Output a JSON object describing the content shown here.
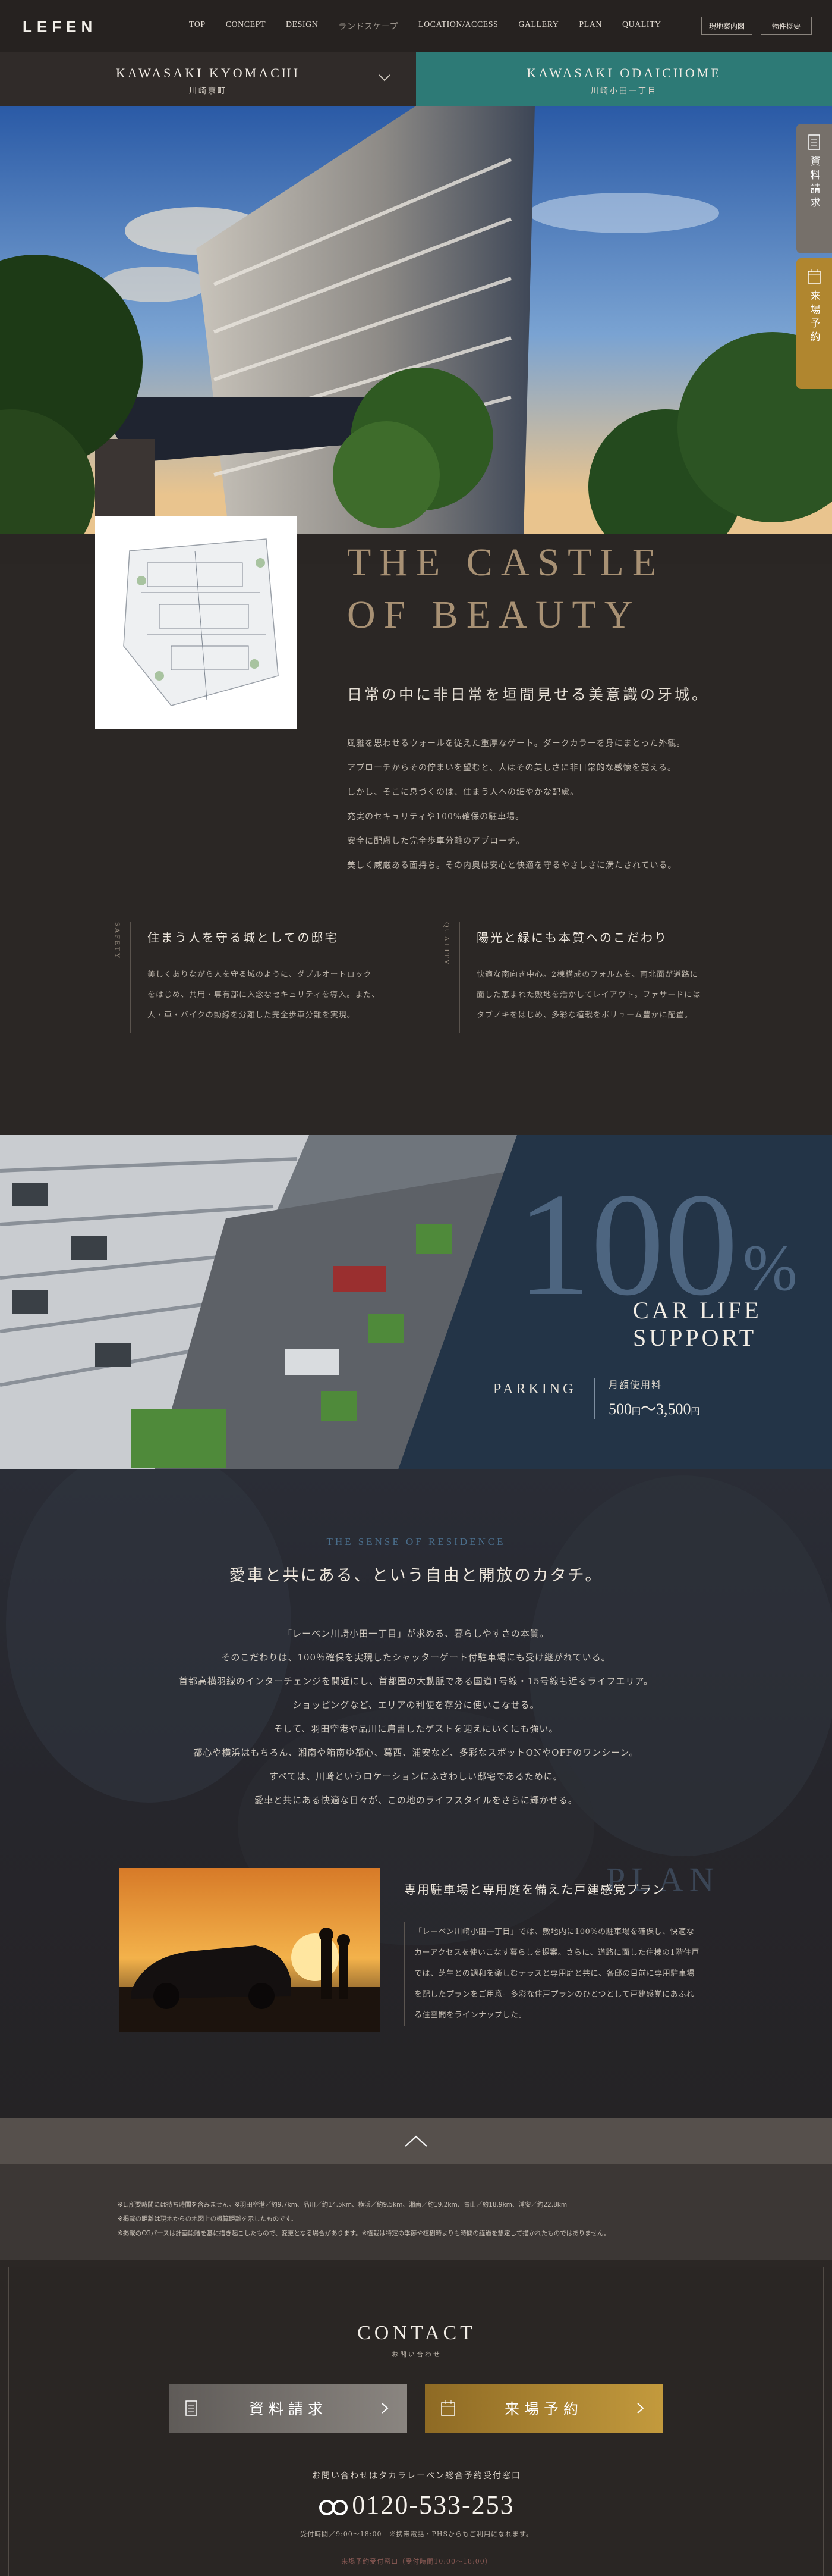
{
  "header": {
    "logo": "LEFEN",
    "nav": [
      "TOP",
      "CONCEPT",
      "DESIGN",
      "ランドスケープ",
      "LOCATION/ACCESS",
      "GALLERY",
      "PLAN",
      "QUALITY"
    ],
    "btn_map": "現地案内図",
    "btn_outline": "物件概要"
  },
  "tabs": [
    {
      "title": "KAWASAKI KYOMACHI",
      "sub": "川崎京町"
    },
    {
      "title": "KAWASAKI ODAICHOME",
      "sub": "川崎小田一丁目"
    }
  ],
  "side": {
    "request": "資料請求",
    "visit": "来場予約"
  },
  "intro": {
    "castle_line1": "THE CASTLE",
    "castle_line2": "OF BEAUTY",
    "lead": "日常の中に非日常を垣間見せる美意識の牙城。",
    "body": [
      "風雅を思わせるウォールを従えた重厚なゲート。ダークカラーを身にまとった外観。",
      "アプローチからその佇まいを望むと、人はその美しさに非日常的な感懐を覚える。",
      "しかし、そこに息づくのは、住まう人への細やかな配慮。",
      "充実のセキュリティや100%確保の駐車場。",
      "安全に配慮した完全歩車分離のアプローチ。",
      "美しく威厳ある面持ち。その内奥は安心と快適を守るやさしさに満たされている。"
    ]
  },
  "features": [
    {
      "tag": "SAFETY",
      "title": "住まう人を守る城としての邸宅",
      "text": [
        "美しくありながら人を守る城のように、ダブルオートロック",
        "をはじめ、共用・専有部に入念なセキュリティを導入。また、",
        "人・車・バイクの動線を分離した完全歩車分離を実現。"
      ]
    },
    {
      "tag": "QUALITY",
      "title": "陽光と緑にも本質へのこだわり",
      "text": [
        "快適な南向き中心。2棟構成のフォルムを、南北面が道路に",
        "面した恵まれた敷地を活かしてレイアウト。ファサードには",
        "タブノキをはじめ、多彩な植栽をボリューム豊かに配置。"
      ]
    }
  ],
  "parking": {
    "big": "100",
    "pct": "%",
    "line1": "CAR LIFE",
    "line2": "SUPPORT",
    "label": "PARKING",
    "fee_label": "月額使用料",
    "fee_from": "500",
    "fee_unit1": "円",
    "fee_sep": "〜",
    "fee_to": "3,500",
    "fee_unit2": "円"
  },
  "sense": {
    "sub": "THE SENSE OF RESIDENCE",
    "head": "愛車と共にある、という自由と開放のカタチ。",
    "body": [
      "「レーベン川崎小田一丁目」が求める、暮らしやすさの本質。",
      "そのこだわりは、100％確保を実現したシャッターゲート付駐車場にも受け継がれている。",
      "首都高横羽線のインターチェンジを間近にし、首都圏の大動脈である国道1号線・15号線も近るライフエリア。",
      "ショッピングなど、エリアの利便を存分に使いこなせる。",
      "そして、羽田空港や品川に肩書したゲストを迎えにいくにも強い。",
      "都心や横浜はもちろん、湘南や箱南ゆ都心、葛西、浦安など、多彩なスポットONやOFFのワンシーン。",
      "すべては、川崎というロケーションにふさわしい邸宅であるために。",
      "愛車と共にある快適な日々が、この地のライフスタイルをさらに輝かせる。"
    ],
    "plan_word": "PLAN",
    "plan_head": "専用駐車場と専用庭を備えた戸建感覚プラン",
    "plan_body": [
      "「レーベン川崎小田一丁目」では、敷地内に100%の駐車場を確保し、快適な",
      "カーアクセスを使いこなす暮らしを提案。さらに、道路に面した住棟の1階住戸",
      "では、芝生との調和を楽しむテラスと専用庭と共に、各邸の目前に専用駐車場",
      "を配したプランをご用意。多彩な住戸プランのひとつとして戸建感覚にあふれ",
      "る住空間をラインナップした。"
    ]
  },
  "notes": [
    "※1.所要時間には待ち時間を含みません。※羽田空港／約9.7km、品川／約14.5km、横浜／約9.5km、湘南／約19.2km、青山／約18.9km、浦安／約22.8km",
    "※掲載の距離は現地からの地図上の概算距離を示したものです。",
    "※掲載のCGパースは計画段階を基に描き起こしたもので、変更となる場合があります。※植栽は特定の季節や植樹時よりも時間の経過を想定して描かれたものではありません。"
  ],
  "contact": {
    "title": "CONTACT",
    "sub": "お問い合わせ",
    "btn_request": "資料請求",
    "btn_visit": "来場予約",
    "lead": "お問い合わせはタカラレーベン総合予約受付窓口",
    "tel": "0120-533-253",
    "hours": "受付時間／9:00〜18:00　※携帯電話・PHSからもご利用になれます。",
    "note": "来場予約受付窓口（受付時間10:00〜18:00）"
  },
  "colors": {
    "bg": "#2b2725",
    "teal": "#2d7a76",
    "gold": "#b0862f",
    "navy": "#233447"
  }
}
